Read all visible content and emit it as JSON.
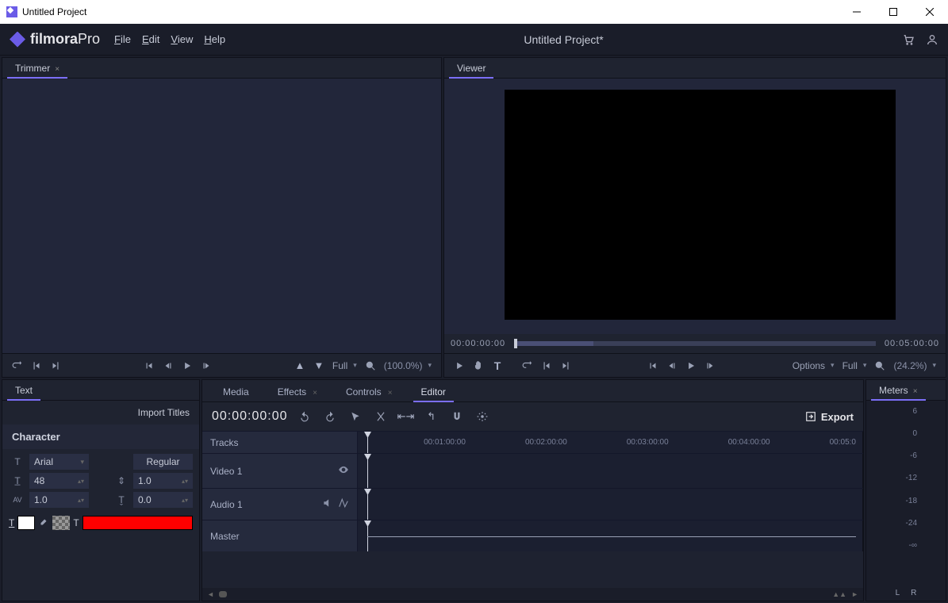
{
  "titlebar": {
    "title": "Untitled Project"
  },
  "appbar": {
    "logo_main": "filmora",
    "logo_sub": "Pro",
    "menu": {
      "file": "File",
      "edit": "Edit",
      "view": "View",
      "help": "Help"
    },
    "project_title": "Untitled Project*"
  },
  "trimmer": {
    "tab_label": "Trimmer",
    "res_label": "Full",
    "zoom": "(100.0%)"
  },
  "viewer": {
    "tab_label": "Viewer",
    "time_start": "00:00:00:00",
    "time_end": "00:05:00:00",
    "options_label": "Options",
    "res_label": "Full",
    "zoom": "(24.2%)"
  },
  "text_panel": {
    "tab_label": "Text",
    "import_titles": "Import Titles",
    "character_label": "Character",
    "font_family": "Arial",
    "font_style": "Regular",
    "font_size": "48",
    "leading": "1.0",
    "tracking_label": "AV",
    "tracking": "1.0",
    "baseline": "0.0"
  },
  "editor": {
    "tabs": {
      "media": "Media",
      "effects": "Effects",
      "controls": "Controls",
      "editor": "Editor"
    },
    "timecode": "00:00:00:00",
    "export_label": "Export",
    "tracks_label": "Tracks",
    "video1": "Video 1",
    "audio1": "Audio 1",
    "master": "Master",
    "ruler": [
      "00:01:00:00",
      "00:02:00:00",
      "00:03:00:00",
      "00:04:00:00",
      "00:05:0"
    ]
  },
  "meters": {
    "tab_label": "Meters",
    "scale": [
      "6",
      "0",
      "-6",
      "-12",
      "-18",
      "-24",
      "-∞"
    ],
    "left": "L",
    "right": "R"
  }
}
